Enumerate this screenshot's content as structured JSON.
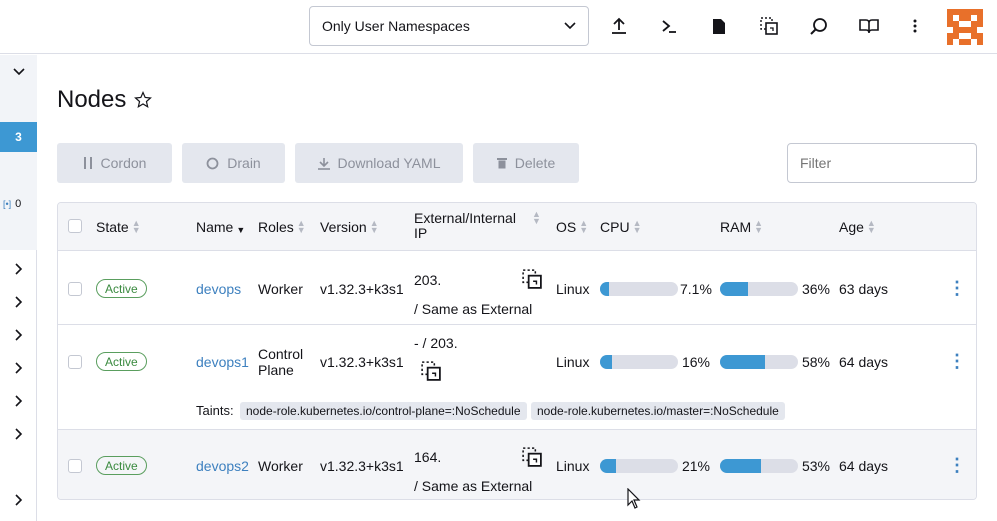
{
  "header": {
    "namespace_select": "Only User Namespaces",
    "icons": [
      "upload-icon",
      "terminal-icon",
      "file-icon",
      "copy-paste-icon",
      "search-icon",
      "book-icon",
      "more-vert-icon"
    ]
  },
  "rail": {
    "badge": "3",
    "count": "0"
  },
  "page": {
    "title": "Nodes"
  },
  "actions": {
    "cordon": "Cordon",
    "drain": "Drain",
    "download": "Download YAML",
    "delete": "Delete"
  },
  "filter": {
    "placeholder": "Filter"
  },
  "table": {
    "headers": {
      "state": "State",
      "name": "Name",
      "roles": "Roles",
      "version": "Version",
      "ip": "External/Internal IP",
      "os": "OS",
      "cpu": "CPU",
      "ram": "RAM",
      "age": "Age"
    },
    "rows": [
      {
        "state": "Active",
        "name": "devops",
        "roles": "Worker",
        "version": "v1.32.3+k3s1",
        "ip1": "203.",
        "ip2": "/ Same as External",
        "os": "Linux",
        "cpu": "7.1%",
        "cpu_frac": 0.071,
        "ram": "36%",
        "ram_frac": 0.36,
        "age": "63 days"
      },
      {
        "state": "Active",
        "name": "devops1",
        "roles": "Control Plane",
        "version": "v1.32.3+k3s1",
        "ip1": "- / 203.",
        "ip2": "",
        "os": "Linux",
        "cpu": "16%",
        "cpu_frac": 0.16,
        "ram": "58%",
        "ram_frac": 0.58,
        "age": "64 days",
        "taints_label": "Taints:",
        "taints": [
          "node-role.kubernetes.io/control-plane=:NoSchedule",
          "node-role.kubernetes.io/master=:NoSchedule"
        ]
      },
      {
        "state": "Active",
        "name": "devops2",
        "roles": "Worker",
        "version": "v1.32.3+k3s1",
        "ip1": "164.",
        "ip2": "/ Same as External",
        "os": "Linux",
        "cpu": "21%",
        "cpu_frac": 0.21,
        "ram": "53%",
        "ram_frac": 0.53,
        "age": "64 days"
      }
    ]
  },
  "colors": {
    "accent": "#3d98d3",
    "active": "#3a8a3f",
    "link": "#3d80bf",
    "avatar": "#e8702a"
  }
}
